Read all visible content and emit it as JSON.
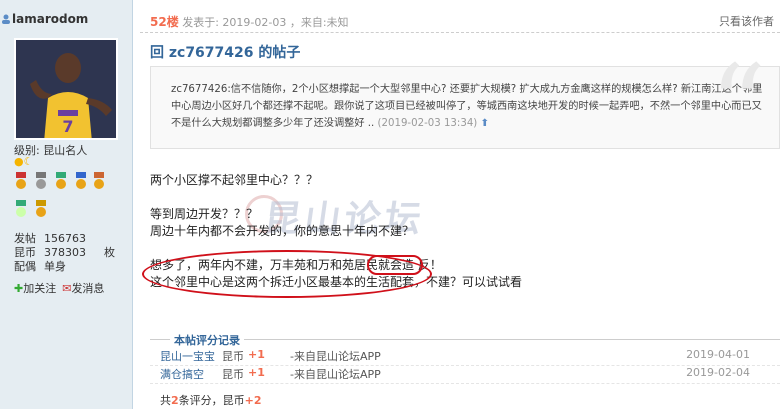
{
  "user": {
    "name": "lamarodom",
    "level_label": "级别: 昆山名人",
    "stats": [
      {
        "key": "发帖",
        "value": "156763",
        "unit": ""
      },
      {
        "key": "昆币",
        "value": "378303",
        "unit": "枚"
      },
      {
        "key": "配偶",
        "value": "单身",
        "unit": ""
      }
    ],
    "actions": {
      "follow": "加关注",
      "message": "发消息"
    }
  },
  "post": {
    "floor": "52楼",
    "meta": "发表于: 2019-02-03 ，来自:未知",
    "only_author": "只看该作者",
    "reply_title": "回 zc7677426 的帖子",
    "quote_text": "zc7677426:信不信随你，2个小区想撑起一个大型邻里中心? 还要扩大规模? 扩大成九方金鹰这样的规模怎么样? 新江南江这个邻里中心周边小区好几个都还撑不起呢。跟你说了这项目已经被叫停了，等城西南这块地开发的时候一起弄吧，不然一个邻里中心而已又不是什么大规划都调整多少年了还没调整好 ..",
    "quote_time": "(2019-02-03 13:34)",
    "lines": [
      "两个小区撑不起邻里中心？？？",
      "等到周边开发？？？",
      "周边十年内都不会开发的，你的意思十年内不建？",
      "想多了，两年内不建，万丰苑和万和苑居民就会造 反！",
      "这个邻里中心是这两个拆迁小区最基本的生活配套，不建？可以试试看"
    ],
    "watermark": "昆山论坛"
  },
  "rating": {
    "title": "本帖评分记录",
    "rows": [
      {
        "who": "昆山一宝宝",
        "currency": "昆币",
        "points": "+1",
        "source": "-来自昆山论坛APP",
        "date": "2019-04-01"
      },
      {
        "who": "满仓搞空",
        "currency": "昆币",
        "points": "+1",
        "source": "-来自昆山论坛APP",
        "date": "2019-02-04"
      }
    ],
    "total_prefix": "共",
    "total_count": "2",
    "total_mid": "条评分，昆币",
    "total_points": "+2"
  }
}
